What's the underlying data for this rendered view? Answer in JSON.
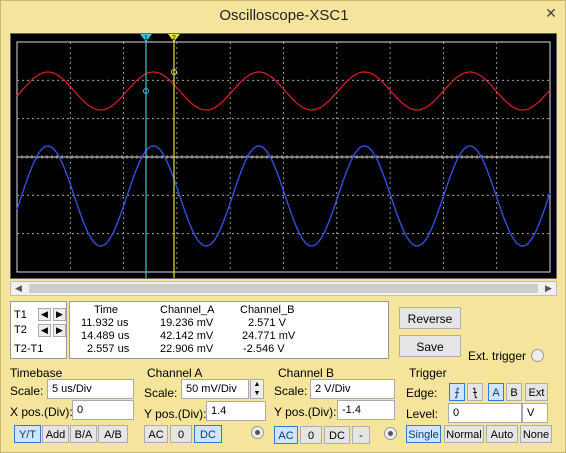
{
  "window": {
    "title": "Oscilloscope-XSC1",
    "close_label": "✕"
  },
  "cursors": {
    "t1_label": "T1",
    "t2_label": "T2",
    "t2t1_label": "T2-T1",
    "t1_marker": "1",
    "t2_marker": "2"
  },
  "readout": {
    "headers": [
      "Time",
      "Channel_A",
      "Channel_B"
    ],
    "rows": [
      [
        "11.932 us",
        "19.236 mV",
        "2.571 V"
      ],
      [
        "14.489 us",
        "42.142 mV",
        "24.771 mV"
      ],
      [
        "2.557 us",
        "22.906 mV",
        "-2.546 V"
      ]
    ]
  },
  "buttons": {
    "reverse": "Reverse",
    "save": "Save",
    "ext_trigger": "Ext. trigger"
  },
  "timebase": {
    "title": "Timebase",
    "scale_label": "Scale:",
    "scale_value": "5 us/Div",
    "xpos_label": "X pos.(Div):",
    "xpos_value": "0",
    "modes": [
      "Y/T",
      "Add",
      "B/A",
      "A/B"
    ]
  },
  "channel_a": {
    "title": "Channel A",
    "scale_label": "Scale:",
    "scale_value": "50 mV/Div",
    "ypos_label": "Y pos.(Div):",
    "ypos_value": "1.4",
    "coupling": [
      "AC",
      "0",
      "DC"
    ]
  },
  "channel_b": {
    "title": "Channel B",
    "scale_label": "Scale:",
    "scale_value": "2 V/Div",
    "ypos_label": "Y pos.(Div):",
    "ypos_value": "-1.4",
    "coupling": [
      "AC",
      "0",
      "DC",
      "-"
    ]
  },
  "trigger": {
    "title": "Trigger",
    "edge_label": "Edge:",
    "edge_buttons": [
      "⨍",
      "⨍",
      "A",
      "B",
      "Ext"
    ],
    "level_label": "Level:",
    "level_value": "0",
    "level_unit": "V",
    "modes": [
      "Single",
      "Normal",
      "Auto",
      "None"
    ]
  },
  "colors": {
    "channel_a": "#e02020",
    "channel_b": "#3050e0",
    "cursor1": "#40c0e0",
    "cursor2": "#e8e040",
    "screen": "#000000",
    "window": "#f4e49c"
  }
}
